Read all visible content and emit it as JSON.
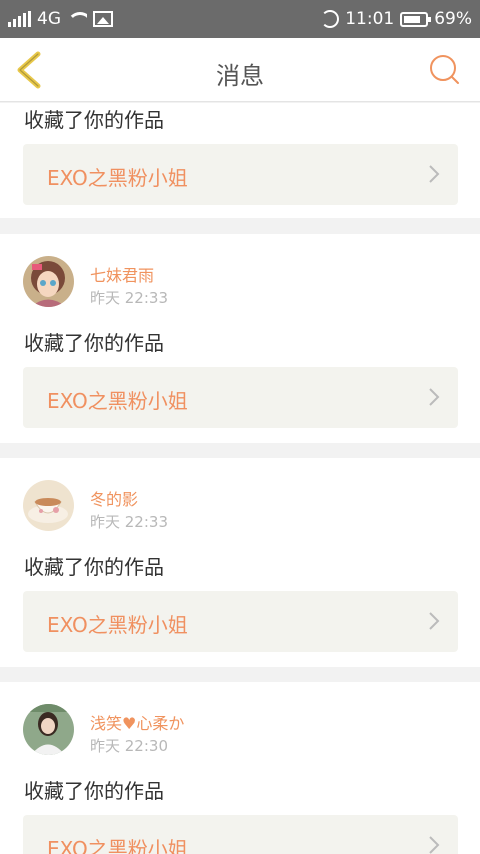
{
  "status_bar": {
    "network": "4G",
    "time": "11:01",
    "battery": "69%"
  },
  "header": {
    "title": "消息",
    "back_icon": "chevron-left-icon",
    "search_icon": "search-icon"
  },
  "colors": {
    "accent": "#f0935e",
    "back_icon": "#e8c84a",
    "work_bg": "#f3f3ee",
    "divider_bg": "#f2f2f2"
  },
  "notifications": [
    {
      "action": "收藏了你的作品",
      "work_title": "EXO之黑粉小姐"
    },
    {
      "user": "七妹君雨",
      "time": "昨天 22:33",
      "action": "收藏了你的作品",
      "work_title": "EXO之黑粉小姐"
    },
    {
      "user": "冬的影",
      "time": "昨天 22:33",
      "action": "收藏了你的作品",
      "work_title": "EXO之黑粉小姐"
    },
    {
      "user": "浅笑♥心柔か",
      "time": "昨天 22:30",
      "action": "收藏了你的作品",
      "work_title": "EXO之黑粉小姐"
    }
  ]
}
